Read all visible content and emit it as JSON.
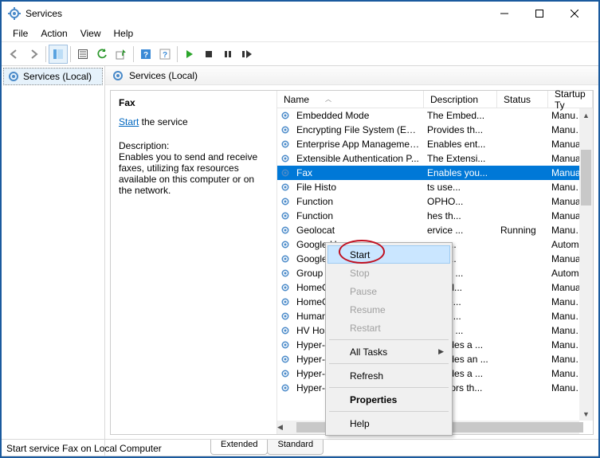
{
  "window": {
    "title": "Services"
  },
  "menubar": [
    "File",
    "Action",
    "View",
    "Help"
  ],
  "tree": {
    "root": "Services (Local)"
  },
  "panel_header": "Services (Local)",
  "detail": {
    "selected": "Fax",
    "start_word": "Start",
    "start_rest": " the service",
    "desc_heading": "Description:",
    "desc_body": "Enables you to send and receive faxes, utilizing fax resources available on this computer or on the network."
  },
  "columns": {
    "name": "Name",
    "desc": "Description",
    "status": "Status",
    "startup": "Startup Ty"
  },
  "services": [
    {
      "name": "Embedded Mode",
      "desc": "The Embed...",
      "status": "",
      "startup": "Manual (T"
    },
    {
      "name": "Encrypting File System (EFS)",
      "desc": "Provides th...",
      "status": "",
      "startup": "Manual (T"
    },
    {
      "name": "Enterprise App Managemen...",
      "desc": "Enables ent...",
      "status": "",
      "startup": "Manual"
    },
    {
      "name": "Extensible Authentication P...",
      "desc": "The Extensi...",
      "status": "",
      "startup": "Manual"
    },
    {
      "name": "Fax",
      "desc": "Enables you...",
      "status": "",
      "startup": "Manual",
      "selected": true
    },
    {
      "name": "File History Service",
      "desc": "Protects use...",
      "status": "",
      "startup": "Manual (T"
    },
    {
      "name": "Function Discovery Provide...",
      "desc": "The FDPHO...",
      "status": "",
      "startup": "Manual"
    },
    {
      "name": "Function Discovery Resour...",
      "desc": "Publishes th...",
      "status": "",
      "startup": "Manual"
    },
    {
      "name": "Geolocation Service",
      "desc": "This service ...",
      "status": "Running",
      "startup": "Manual (T"
    },
    {
      "name": "Google Update Service (gu...",
      "desc": "Keeps your ...",
      "status": "",
      "startup": "Automatic"
    },
    {
      "name": "Google Update Service (gu...",
      "desc": "Keeps your ...",
      "status": "",
      "startup": "Manual"
    },
    {
      "name": "Group Policy Client",
      "desc": "The service ...",
      "status": "",
      "startup": "Automatic"
    },
    {
      "name": "HomeGroup Listener",
      "desc": "Makes local...",
      "status": "",
      "startup": "Manual"
    },
    {
      "name": "HomeGroup Provider",
      "desc": "Performs ne...",
      "status": "",
      "startup": "Manual (T"
    },
    {
      "name": "Human Interface Device Se...",
      "desc": "Activates an...",
      "status": "",
      "startup": "Manual (T"
    },
    {
      "name": "HV Host Service",
      "desc": "Provides an ...",
      "status": "",
      "startup": "Manual (T"
    },
    {
      "name": "Hyper-V Data Exchange Ser...",
      "desc": "Provides a ...",
      "status": "",
      "startup": "Manual (T"
    },
    {
      "name": "Hyper-V Guest Service Inter...",
      "desc": "Provides an ...",
      "status": "",
      "startup": "Manual (T"
    },
    {
      "name": "Hyper-V Guest Shutdown S...",
      "desc": "Provides a ...",
      "status": "",
      "startup": "Manual (T"
    },
    {
      "name": "Hyper-V Heartbeat Service",
      "desc": "Monitors th...",
      "status": "",
      "startup": "Manual (T"
    }
  ],
  "occluded_name_map": {
    "5": "File Histo",
    "6": "Function",
    "7": "Function",
    "8": "Geolocat",
    "9": "Google U",
    "10": "Google U",
    "11": "Group Po",
    "12": "HomeGro",
    "13": "HomeGro",
    "14": "Human In",
    "15": "HV Host"
  },
  "occluded_desc_map": {
    "5": "ts use...",
    "6": "OPHO...",
    "7": "hes th...",
    "8": "ervice ...",
    "9": "your ...",
    "10": "your ...",
    "11": "ervice ...",
    "12": "s local...",
    "13": "ms ne...",
    "14": "tes an...",
    "15": "les an ..."
  },
  "context_menu": [
    {
      "label": "Start",
      "hover": true
    },
    {
      "label": "Stop",
      "disabled": true
    },
    {
      "label": "Pause",
      "disabled": true
    },
    {
      "label": "Resume",
      "disabled": true
    },
    {
      "label": "Restart",
      "disabled": true
    },
    {
      "sep": true
    },
    {
      "label": "All Tasks",
      "sub": true
    },
    {
      "sep": true
    },
    {
      "label": "Refresh"
    },
    {
      "sep": true
    },
    {
      "label": "Properties",
      "bold": true
    },
    {
      "sep": true
    },
    {
      "label": "Help"
    }
  ],
  "tabs": {
    "extended": "Extended",
    "standard": "Standard"
  },
  "statusbar": "Start service Fax on Local Computer"
}
